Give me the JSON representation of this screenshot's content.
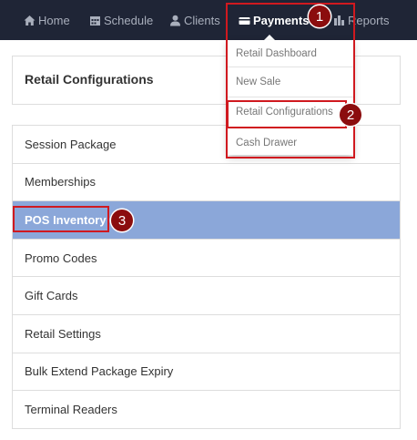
{
  "nav": {
    "home": "Home",
    "schedule": "Schedule",
    "clients": "Clients",
    "payments": "Payments",
    "reports": "Reports"
  },
  "dropdown": {
    "items": [
      "Retail Dashboard",
      "New Sale",
      "Retail Configurations",
      "Cash Drawer"
    ]
  },
  "header": {
    "title": "Retail Configurations"
  },
  "menu": {
    "items": [
      "Session Package",
      "Memberships",
      "POS Inventory",
      "Promo Codes",
      "Gift Cards",
      "Retail Settings",
      "Bulk Extend Package Expiry",
      "Terminal Readers"
    ],
    "selected": "POS Inventory"
  },
  "annotations": {
    "markers": [
      "1",
      "2",
      "3"
    ]
  },
  "colors": {
    "nav_bg": "#1f2536",
    "selected_row": "#8ba7d9",
    "highlight": "#d0191f",
    "marker": "#8b0d0e"
  },
  "icons": {
    "home": "house-icon",
    "schedule": "calendar-icon",
    "clients": "user-icon",
    "payments": "credit-card-icon",
    "reports": "bar-chart-icon"
  }
}
